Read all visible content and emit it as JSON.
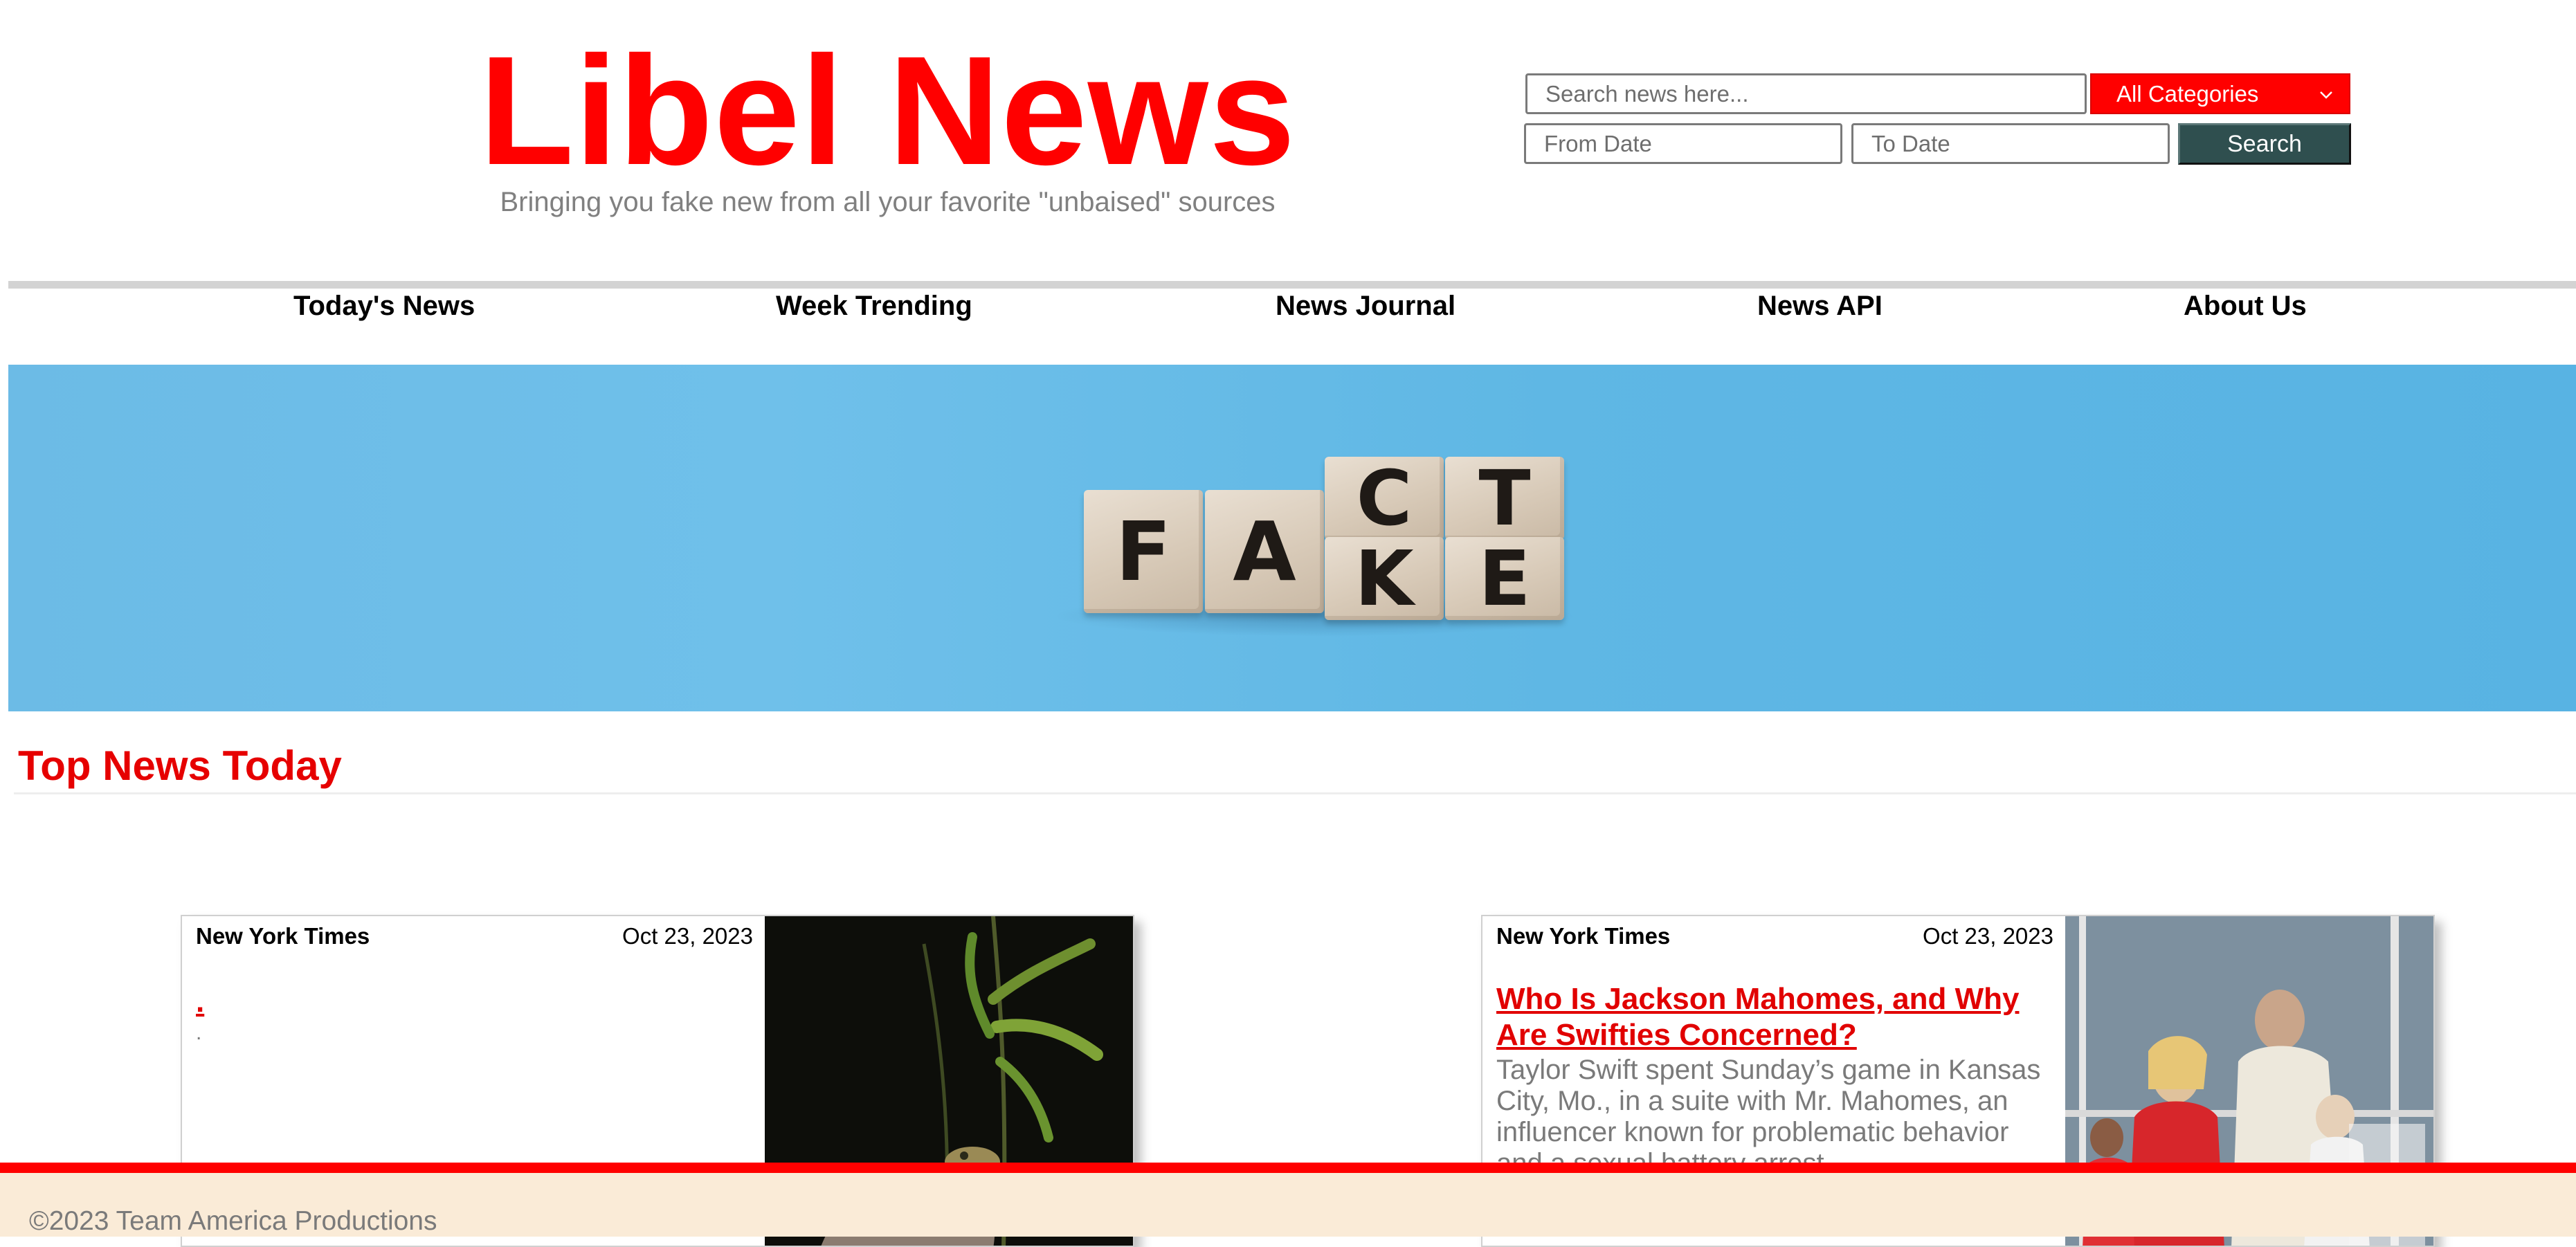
{
  "header": {
    "site_title": "Libel News",
    "tagline": "Bringing you fake new from all your favorite \"unbaised\" sources"
  },
  "search": {
    "placeholder": "Search news here...",
    "category_selected": "All Categories",
    "from_date_placeholder": "From Date",
    "to_date_placeholder": "To Date",
    "button_label": "Search"
  },
  "nav": {
    "items": [
      {
        "label": "Today's News"
      },
      {
        "label": "Week Trending"
      },
      {
        "label": "News Journal"
      },
      {
        "label": "News API"
      },
      {
        "label": "About Us"
      }
    ]
  },
  "hero": {
    "cubes": [
      {
        "letter": "F"
      },
      {
        "letter": "A"
      },
      {
        "letter": "C"
      },
      {
        "letter": "T"
      },
      {
        "letter": "K"
      },
      {
        "letter": "E"
      }
    ]
  },
  "section": {
    "title": "Top News Today"
  },
  "articles": [
    {
      "source": "New York Times",
      "date": "Oct 23, 2023",
      "headline": ".",
      "summary": "."
    },
    {
      "source": "New York Times",
      "date": "Oct 23, 2023",
      "headline": "Who Is Jackson Mahomes, and Why Are Swifties Concerned?",
      "summary": "Taylor Swift spent Sunday’s game in Kansas City, Mo., in a suite with Mr. Mahomes, an influencer known for problematic behavior and a sexual battery arrest."
    }
  ],
  "footer": {
    "copyright": "©2023 Team America Productions"
  },
  "colors": {
    "brand_red": "#ff0000",
    "search_button": "#2f4f4f",
    "footer_bg": "#faebd7",
    "hero_blue": "#6cbbe6"
  }
}
